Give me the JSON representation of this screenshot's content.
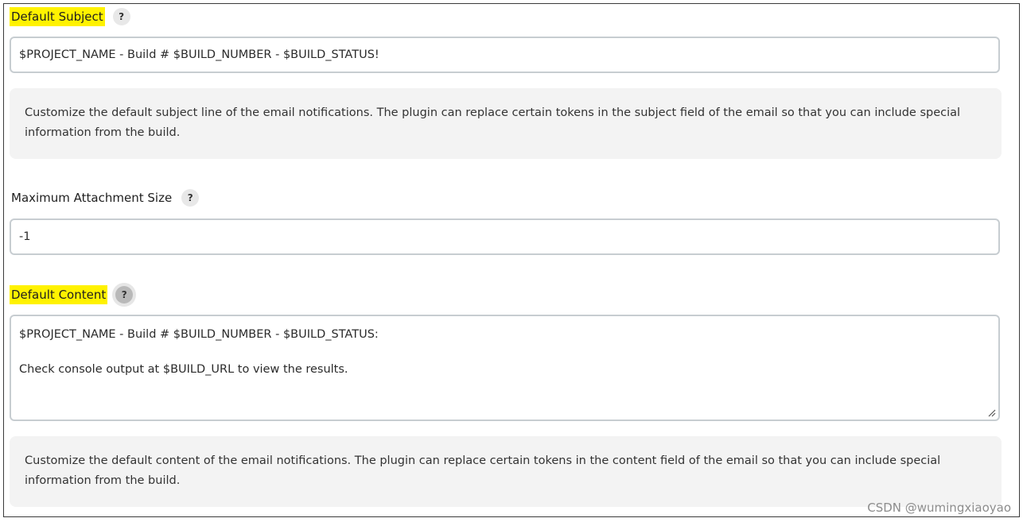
{
  "default_subject": {
    "label": "Default Subject",
    "help_icon": "?",
    "value": "$PROJECT_NAME - Build # $BUILD_NUMBER - $BUILD_STATUS!",
    "help_text": "Customize the default subject line of the email notifications. The plugin can replace certain tokens in the subject field of the email so that you can include special information from the build."
  },
  "max_attachment": {
    "label": "Maximum Attachment Size",
    "help_icon": "?",
    "value": "-1"
  },
  "default_content": {
    "label": "Default Content",
    "help_icon": "?",
    "line1": "$PROJECT_NAME - Build # $BUILD_NUMBER - $BUILD_STATUS:",
    "line2": "",
    "line3": "Check console output at $BUILD_URL to view the results.",
    "help_text": "Customize the default content of the email notifications. The plugin can replace certain tokens in the content field of the email so that you can include special information from the build."
  },
  "watermark": "CSDN @wumingxiaoyao",
  "colors": {
    "highlight": "#fff200",
    "input_border": "#c7cdd1",
    "help_bg": "#f3f3f3"
  }
}
